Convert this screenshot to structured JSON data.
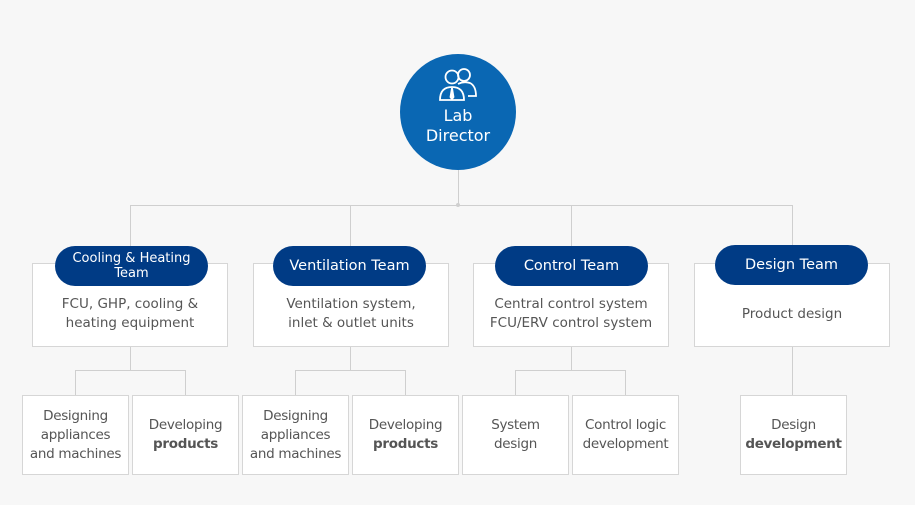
{
  "director": {
    "lines": [
      "Lab",
      "Director"
    ],
    "icon": "people-icon",
    "color": "#0a67b3"
  },
  "teams": [
    {
      "name_lines": [
        "Cooling & Heating",
        "Team"
      ],
      "desc_lines": [
        "FCU, GHP, cooling &",
        "heating equipment"
      ],
      "subs": [
        {
          "lines": [
            "Designing",
            "appliances",
            "and machines"
          ],
          "bold": ""
        },
        {
          "lines": [
            "Developing"
          ],
          "bold": "products"
        }
      ]
    },
    {
      "name_lines": [
        "Ventilation Team"
      ],
      "desc_lines": [
        "Ventilation system,",
        "inlet & outlet units"
      ],
      "subs": [
        {
          "lines": [
            "Designing",
            "appliances",
            "and machines"
          ],
          "bold": ""
        },
        {
          "lines": [
            "Developing"
          ],
          "bold": "products"
        }
      ]
    },
    {
      "name_lines": [
        "Control Team"
      ],
      "desc_lines": [
        "Central control system",
        "FCU/ERV control system"
      ],
      "subs": [
        {
          "lines": [
            "System",
            "design"
          ],
          "bold": ""
        },
        {
          "lines": [
            "Control logic",
            "development"
          ],
          "bold": ""
        }
      ]
    },
    {
      "name_lines": [
        "Design Team"
      ],
      "desc_lines": [
        "Product design"
      ],
      "subs": [
        {
          "lines": [
            "Design"
          ],
          "bold": "development"
        }
      ]
    }
  ],
  "colors": {
    "team_pill": "#003b85",
    "connector": "#cfcfcf"
  }
}
